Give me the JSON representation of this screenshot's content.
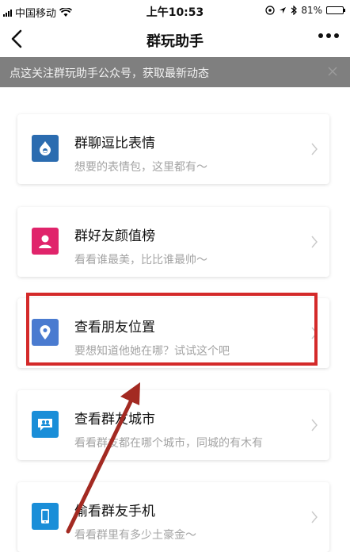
{
  "status_bar": {
    "carrier": "中国移动",
    "time": "上午10:53",
    "battery": "81%",
    "battery_level": 0.81,
    "icons": [
      "signal-icon",
      "wifi-icon",
      "location-icon",
      "bluetooth-icon",
      "battery-icon"
    ]
  },
  "nav": {
    "title": "群玩助手",
    "icons": [
      "back-arrow-icon",
      "more-dots-icon"
    ]
  },
  "notice": {
    "text": "点这关注群玩助手公众号，获取最新动态",
    "icon": "close-icon"
  },
  "items": [
    {
      "title": "群聊逗比表情",
      "subtitle": "想要的表情包，这里都有～",
      "icon": "sticker-drop-icon",
      "color": "#2b6cb0"
    },
    {
      "title": "群好友颜值榜",
      "subtitle": "看看谁最美，比比谁最帅～",
      "icon": "person-icon",
      "color": "#e0246b"
    },
    {
      "title": "查看朋友位置",
      "subtitle": "要想知道他她在哪？试试这个吧",
      "icon": "location-pin-icon",
      "color": "#4a7bd0"
    },
    {
      "title": "查看群友城市",
      "subtitle": "看看群友都在哪个城市，同城的有木有",
      "icon": "chat-people-icon",
      "color": "#1a8ed8"
    },
    {
      "title": "偷看群友手机",
      "subtitle": "看看群里有多少土豪金～",
      "icon": "phone-icon",
      "color": "#1a8ed8"
    }
  ],
  "annotation": {
    "highlight_color": "#d42a2a"
  }
}
